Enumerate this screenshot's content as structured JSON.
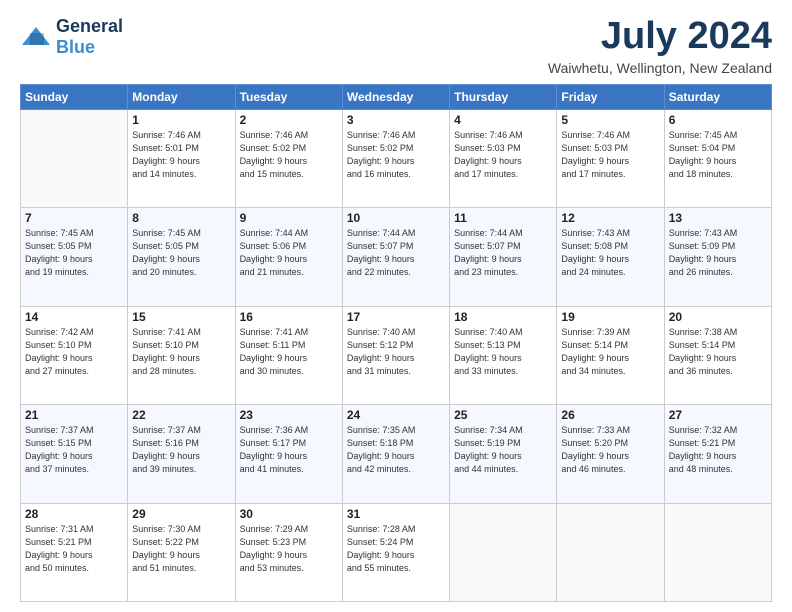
{
  "header": {
    "logo_general": "General",
    "logo_blue": "Blue",
    "month_title": "July 2024",
    "location": "Waiwhetu, Wellington, New Zealand"
  },
  "days_of_week": [
    "Sunday",
    "Monday",
    "Tuesday",
    "Wednesday",
    "Thursday",
    "Friday",
    "Saturday"
  ],
  "weeks": [
    [
      {
        "day": "",
        "info": ""
      },
      {
        "day": "1",
        "info": "Sunrise: 7:46 AM\nSunset: 5:01 PM\nDaylight: 9 hours\nand 14 minutes."
      },
      {
        "day": "2",
        "info": "Sunrise: 7:46 AM\nSunset: 5:02 PM\nDaylight: 9 hours\nand 15 minutes."
      },
      {
        "day": "3",
        "info": "Sunrise: 7:46 AM\nSunset: 5:02 PM\nDaylight: 9 hours\nand 16 minutes."
      },
      {
        "day": "4",
        "info": "Sunrise: 7:46 AM\nSunset: 5:03 PM\nDaylight: 9 hours\nand 17 minutes."
      },
      {
        "day": "5",
        "info": "Sunrise: 7:46 AM\nSunset: 5:03 PM\nDaylight: 9 hours\nand 17 minutes."
      },
      {
        "day": "6",
        "info": "Sunrise: 7:45 AM\nSunset: 5:04 PM\nDaylight: 9 hours\nand 18 minutes."
      }
    ],
    [
      {
        "day": "7",
        "info": "Sunrise: 7:45 AM\nSunset: 5:05 PM\nDaylight: 9 hours\nand 19 minutes."
      },
      {
        "day": "8",
        "info": "Sunrise: 7:45 AM\nSunset: 5:05 PM\nDaylight: 9 hours\nand 20 minutes."
      },
      {
        "day": "9",
        "info": "Sunrise: 7:44 AM\nSunset: 5:06 PM\nDaylight: 9 hours\nand 21 minutes."
      },
      {
        "day": "10",
        "info": "Sunrise: 7:44 AM\nSunset: 5:07 PM\nDaylight: 9 hours\nand 22 minutes."
      },
      {
        "day": "11",
        "info": "Sunrise: 7:44 AM\nSunset: 5:07 PM\nDaylight: 9 hours\nand 23 minutes."
      },
      {
        "day": "12",
        "info": "Sunrise: 7:43 AM\nSunset: 5:08 PM\nDaylight: 9 hours\nand 24 minutes."
      },
      {
        "day": "13",
        "info": "Sunrise: 7:43 AM\nSunset: 5:09 PM\nDaylight: 9 hours\nand 26 minutes."
      }
    ],
    [
      {
        "day": "14",
        "info": "Sunrise: 7:42 AM\nSunset: 5:10 PM\nDaylight: 9 hours\nand 27 minutes."
      },
      {
        "day": "15",
        "info": "Sunrise: 7:41 AM\nSunset: 5:10 PM\nDaylight: 9 hours\nand 28 minutes."
      },
      {
        "day": "16",
        "info": "Sunrise: 7:41 AM\nSunset: 5:11 PM\nDaylight: 9 hours\nand 30 minutes."
      },
      {
        "day": "17",
        "info": "Sunrise: 7:40 AM\nSunset: 5:12 PM\nDaylight: 9 hours\nand 31 minutes."
      },
      {
        "day": "18",
        "info": "Sunrise: 7:40 AM\nSunset: 5:13 PM\nDaylight: 9 hours\nand 33 minutes."
      },
      {
        "day": "19",
        "info": "Sunrise: 7:39 AM\nSunset: 5:14 PM\nDaylight: 9 hours\nand 34 minutes."
      },
      {
        "day": "20",
        "info": "Sunrise: 7:38 AM\nSunset: 5:14 PM\nDaylight: 9 hours\nand 36 minutes."
      }
    ],
    [
      {
        "day": "21",
        "info": "Sunrise: 7:37 AM\nSunset: 5:15 PM\nDaylight: 9 hours\nand 37 minutes."
      },
      {
        "day": "22",
        "info": "Sunrise: 7:37 AM\nSunset: 5:16 PM\nDaylight: 9 hours\nand 39 minutes."
      },
      {
        "day": "23",
        "info": "Sunrise: 7:36 AM\nSunset: 5:17 PM\nDaylight: 9 hours\nand 41 minutes."
      },
      {
        "day": "24",
        "info": "Sunrise: 7:35 AM\nSunset: 5:18 PM\nDaylight: 9 hours\nand 42 minutes."
      },
      {
        "day": "25",
        "info": "Sunrise: 7:34 AM\nSunset: 5:19 PM\nDaylight: 9 hours\nand 44 minutes."
      },
      {
        "day": "26",
        "info": "Sunrise: 7:33 AM\nSunset: 5:20 PM\nDaylight: 9 hours\nand 46 minutes."
      },
      {
        "day": "27",
        "info": "Sunrise: 7:32 AM\nSunset: 5:21 PM\nDaylight: 9 hours\nand 48 minutes."
      }
    ],
    [
      {
        "day": "28",
        "info": "Sunrise: 7:31 AM\nSunset: 5:21 PM\nDaylight: 9 hours\nand 50 minutes."
      },
      {
        "day": "29",
        "info": "Sunrise: 7:30 AM\nSunset: 5:22 PM\nDaylight: 9 hours\nand 51 minutes."
      },
      {
        "day": "30",
        "info": "Sunrise: 7:29 AM\nSunset: 5:23 PM\nDaylight: 9 hours\nand 53 minutes."
      },
      {
        "day": "31",
        "info": "Sunrise: 7:28 AM\nSunset: 5:24 PM\nDaylight: 9 hours\nand 55 minutes."
      },
      {
        "day": "",
        "info": ""
      },
      {
        "day": "",
        "info": ""
      },
      {
        "day": "",
        "info": ""
      }
    ]
  ]
}
